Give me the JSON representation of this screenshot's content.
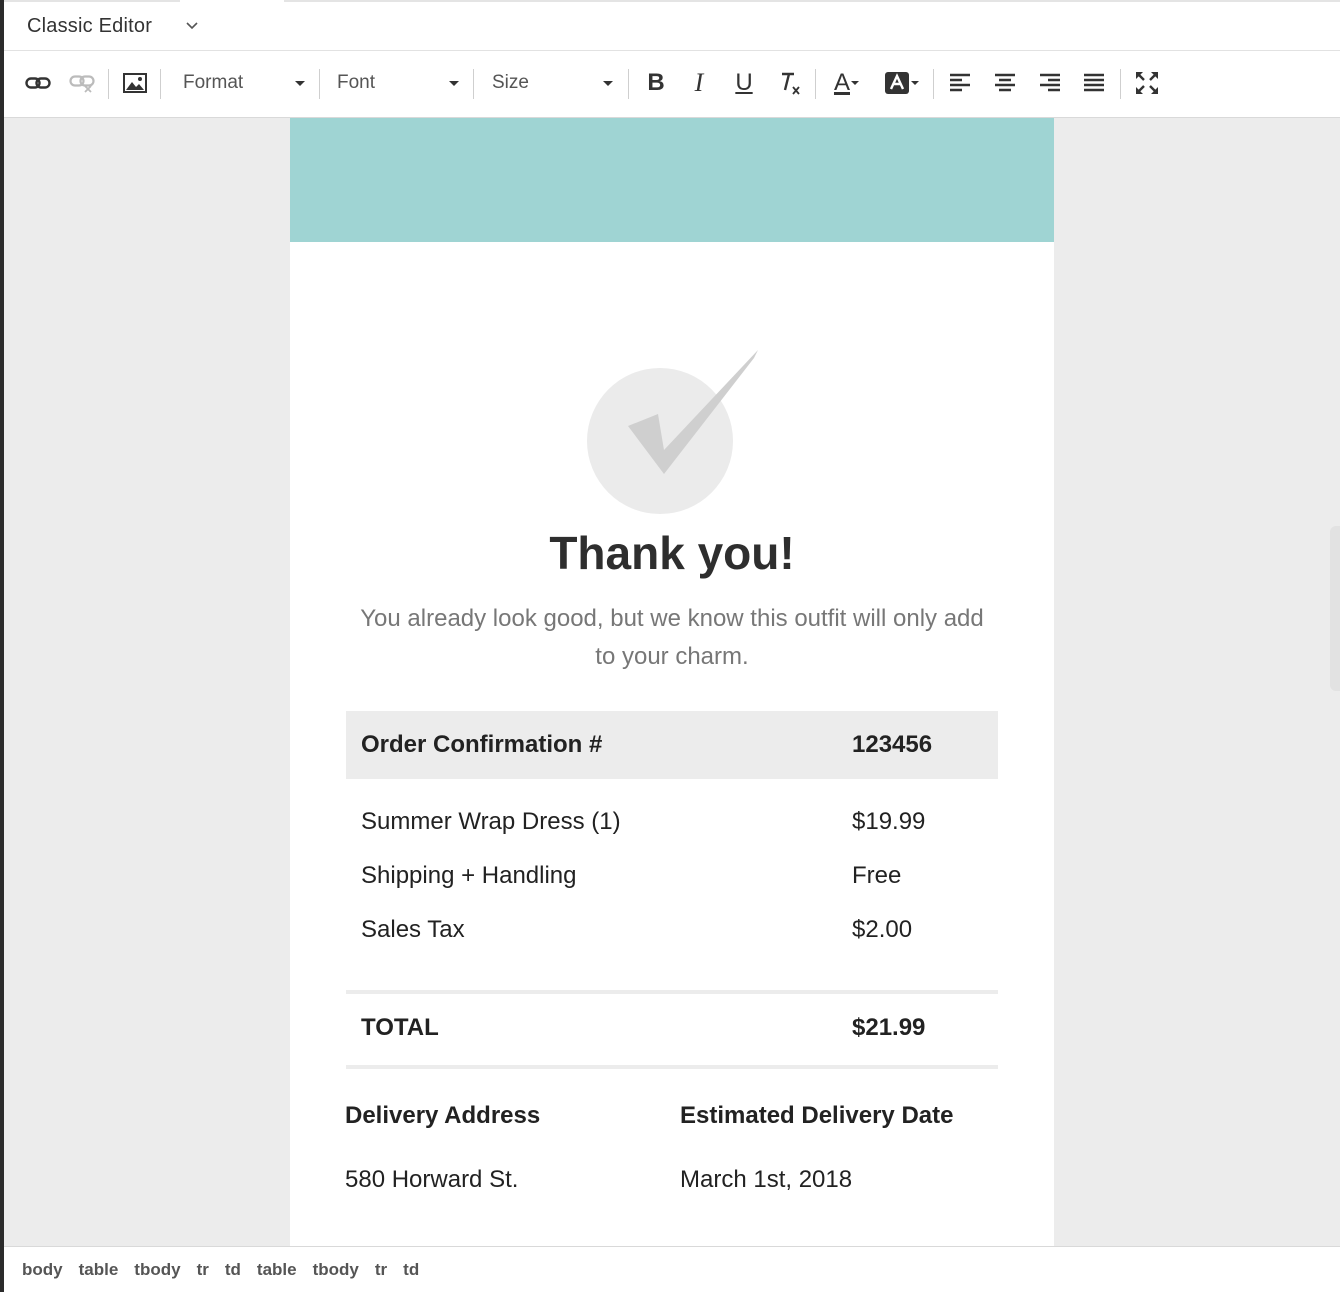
{
  "editor": {
    "mode_label": "Classic Editor",
    "toolbar": {
      "format_label": "Format",
      "font_label": "Font",
      "size_label": "Size",
      "bold_glyph": "B",
      "italic_glyph": "I",
      "underline_glyph": "U",
      "text_color_glyph": "A"
    },
    "path": [
      "body",
      "table",
      "tbody",
      "tr",
      "td",
      "table",
      "tbody",
      "tr",
      "td"
    ]
  },
  "email": {
    "banner_color": "#9fd4d3",
    "title": "Thank you!",
    "subtext": "You already look good, but we know this outfit will only add to your charm.",
    "order": {
      "label": "Order Confirmation #",
      "number": "123456"
    },
    "items": [
      {
        "label": "Summer Wrap Dress (1)",
        "value": "$19.99"
      },
      {
        "label": "Shipping + Handling",
        "value": "Free"
      },
      {
        "label": "Sales Tax",
        "value": "$2.00"
      }
    ],
    "total": {
      "label": "TOTAL",
      "value": "$21.99"
    },
    "delivery": {
      "address_label": "Delivery Address",
      "address": "580 Horward St.",
      "date_label": "Estimated Delivery Date",
      "date": "March 1st, 2018"
    }
  }
}
